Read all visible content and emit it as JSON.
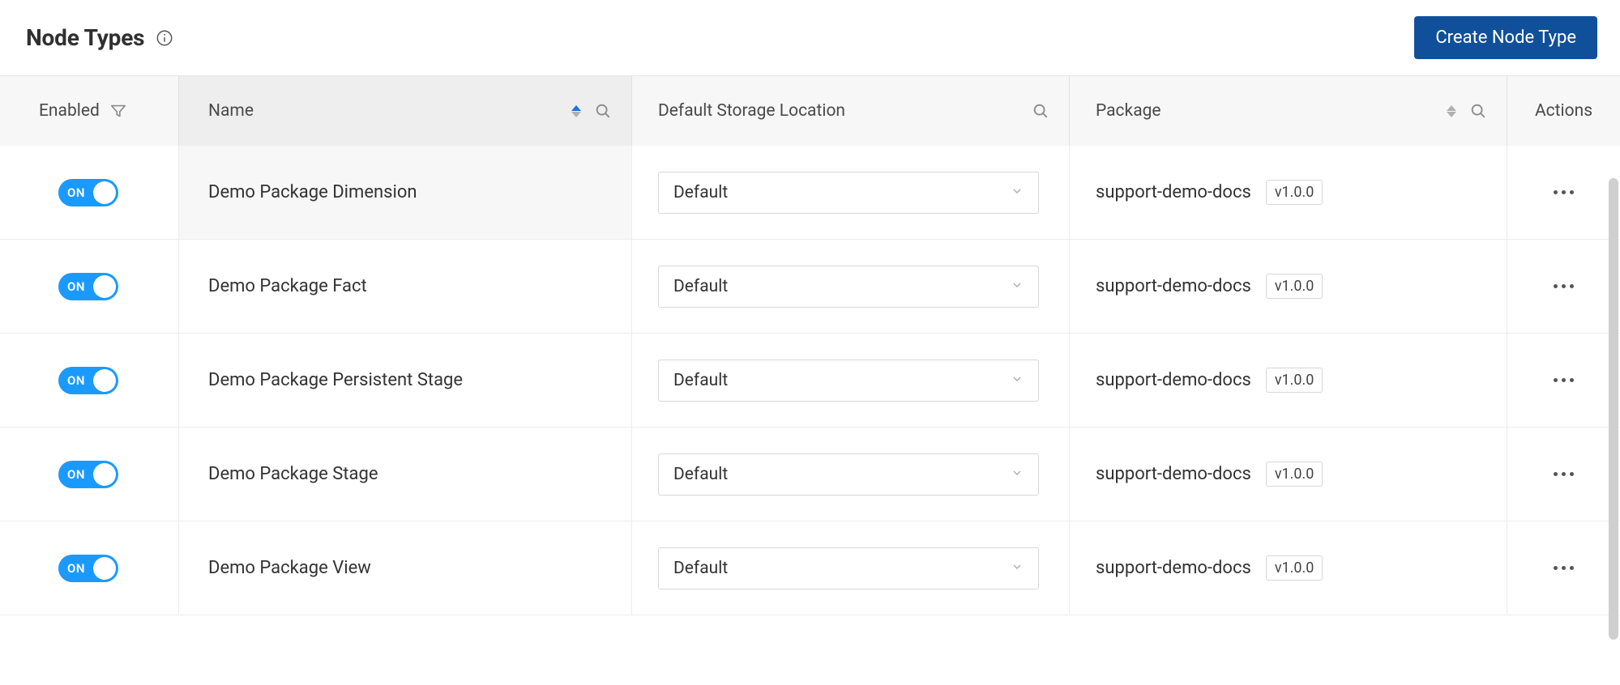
{
  "header": {
    "title": "Node Types",
    "create_btn": "Create Node Type"
  },
  "columns": {
    "enabled": "Enabled",
    "name": "Name",
    "storage": "Default Storage Location",
    "package": "Package",
    "actions": "Actions"
  },
  "toggle_on_label": "ON",
  "rows": [
    {
      "name": "Demo Package Dimension",
      "storage": "Default",
      "package": "support-demo-docs",
      "version": "v1.0.0"
    },
    {
      "name": "Demo Package Fact",
      "storage": "Default",
      "package": "support-demo-docs",
      "version": "v1.0.0"
    },
    {
      "name": "Demo Package Persistent Stage",
      "storage": "Default",
      "package": "support-demo-docs",
      "version": "v1.0.0"
    },
    {
      "name": "Demo Package Stage",
      "storage": "Default",
      "package": "support-demo-docs",
      "version": "v1.0.0"
    },
    {
      "name": "Demo Package View",
      "storage": "Default",
      "package": "support-demo-docs",
      "version": "v1.0.0"
    }
  ]
}
